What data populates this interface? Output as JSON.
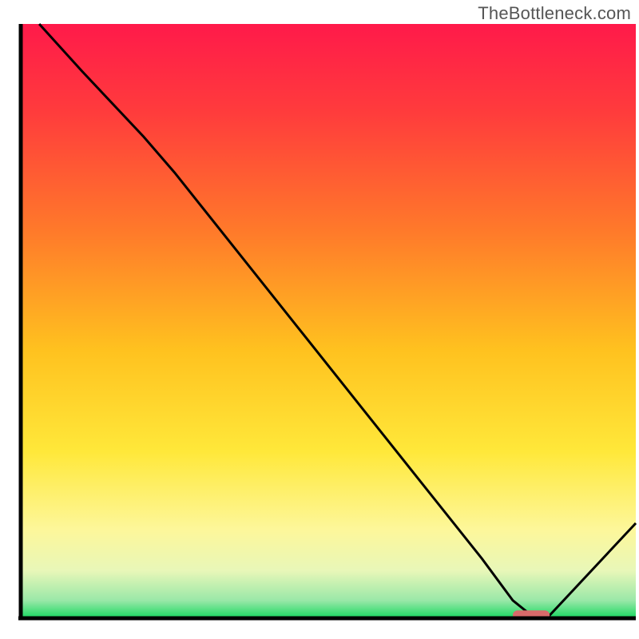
{
  "watermark": "TheBottleneck.com",
  "chart_data": {
    "type": "line",
    "title": "",
    "xlabel": "",
    "ylabel": "",
    "xlim": [
      0,
      100
    ],
    "ylim": [
      0,
      100
    ],
    "x": [
      3,
      10,
      20,
      25,
      35,
      45,
      55,
      65,
      75,
      80,
      83,
      86,
      100
    ],
    "values": [
      100,
      92,
      81,
      75,
      62,
      49,
      36,
      23,
      10,
      3,
      0.5,
      0.5,
      16
    ],
    "marker": {
      "x_range": [
        80,
        86
      ],
      "y": 0.5
    },
    "gradient_stops": [
      {
        "offset": 0.0,
        "color": "#ff1a4a"
      },
      {
        "offset": 0.15,
        "color": "#ff3c3c"
      },
      {
        "offset": 0.35,
        "color": "#ff7a2a"
      },
      {
        "offset": 0.55,
        "color": "#ffc21f"
      },
      {
        "offset": 0.72,
        "color": "#ffe83a"
      },
      {
        "offset": 0.85,
        "color": "#fdf79a"
      },
      {
        "offset": 0.92,
        "color": "#e8f7b8"
      },
      {
        "offset": 0.97,
        "color": "#9ae8a8"
      },
      {
        "offset": 1.0,
        "color": "#18d860"
      }
    ],
    "axis_color": "#000000",
    "curve_color": "#000000",
    "marker_color": "#d96a6a"
  },
  "plot": {
    "outer_x": 0,
    "outer_y": 30,
    "outer_w": 800,
    "outer_h": 770,
    "inner_x": 26,
    "inner_y": 30,
    "inner_w": 770,
    "inner_h": 744
  }
}
